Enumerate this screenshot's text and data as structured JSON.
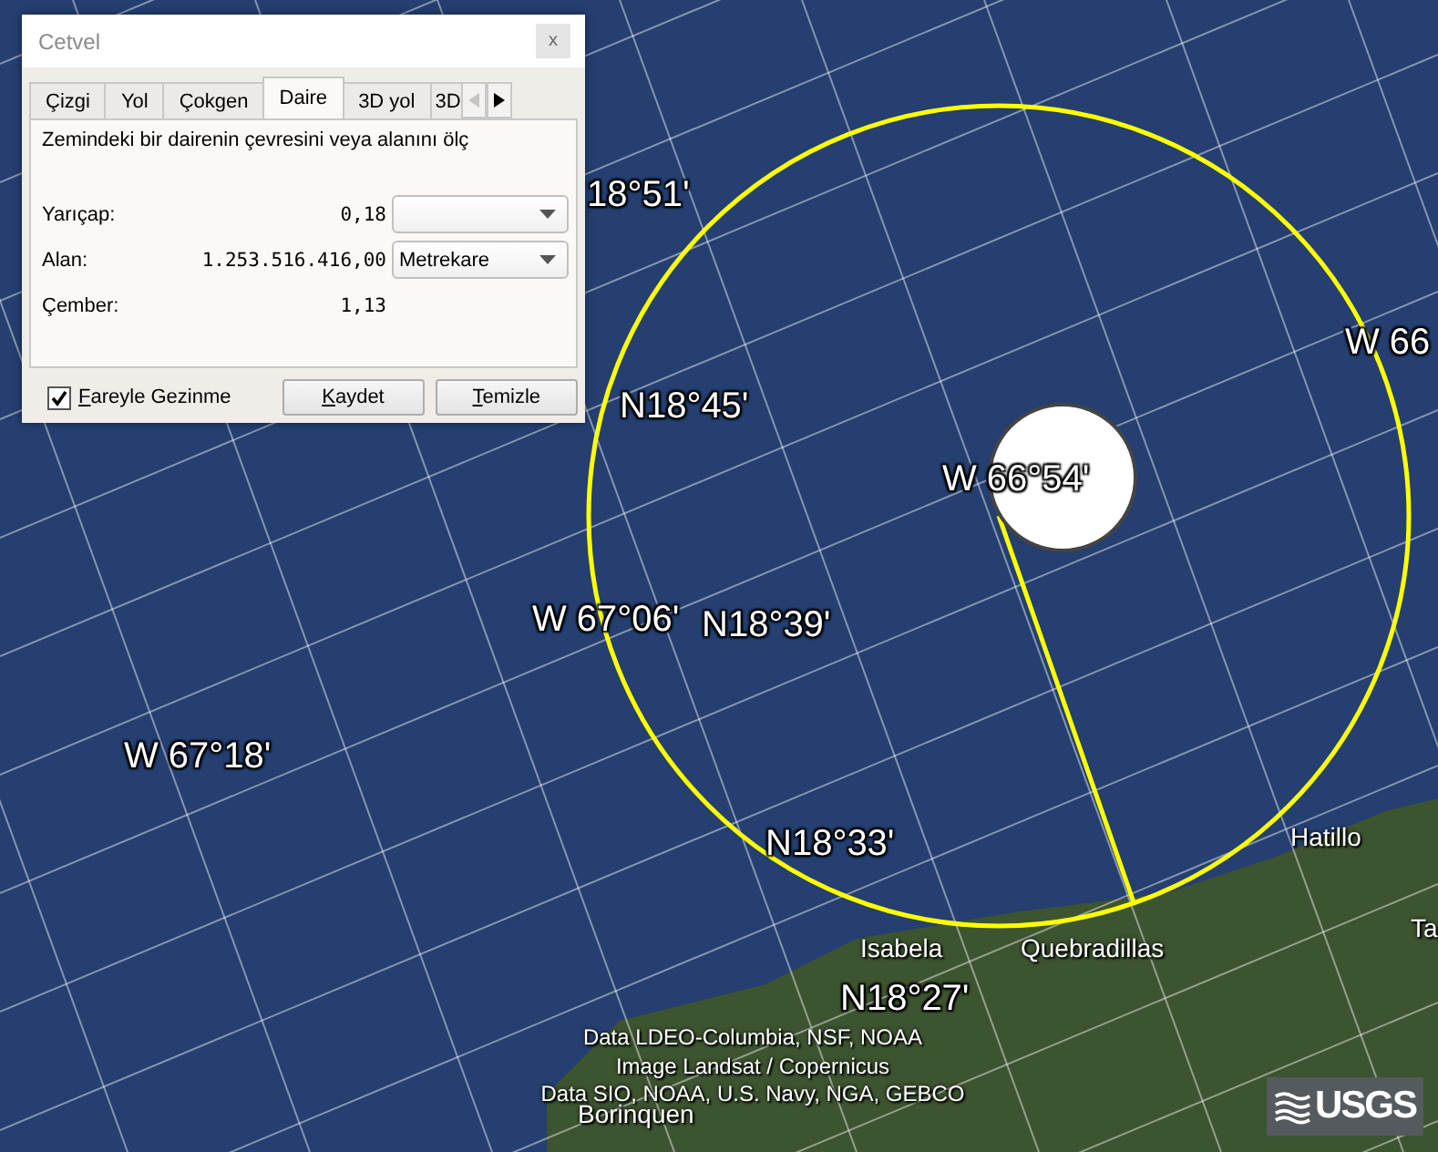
{
  "map": {
    "grid_labels": [
      "18°51'",
      "W 66",
      "N18°45'",
      "W 66°54'",
      "W 67°06'",
      "N18°39'",
      "W 67°18'",
      "N18°33'",
      "N18°27'"
    ],
    "place_labels": [
      "Hatillo",
      "Ta",
      "Isabela",
      "Quebradillas",
      "Borinquen"
    ],
    "attribution": [
      "Data LDEO-Columbia, NSF, NOAA",
      "Image Landsat / Copernicus",
      "Data SIO, NOAA, U.S. Navy, NGA, GEBCO"
    ],
    "logo": "USGS"
  },
  "dialog": {
    "title": "Cetvel",
    "close": "x",
    "tabs": [
      {
        "label": "Çizgi",
        "selected": false
      },
      {
        "label": "Yol",
        "selected": false
      },
      {
        "label": "Çokgen",
        "selected": false
      },
      {
        "label": "Daire",
        "selected": true
      },
      {
        "label": "3D yol",
        "selected": false
      },
      {
        "label": "3D",
        "selected": false
      }
    ],
    "description": "Zemindeki bir dairenin çevresini veya alanını ölç",
    "rows": [
      {
        "label": "Yarıçap:",
        "value": "0,18",
        "kind": "dropdown"
      },
      {
        "label": "Alan:",
        "value": "1.253.516.416,00",
        "kind": "dropdown",
        "unit": "Metrekare"
      },
      {
        "label": "Çember:",
        "value": "1,13",
        "kind": "plain"
      }
    ],
    "mouse_nav": {
      "label": "Fareyle Gezinme",
      "checked": true
    },
    "buttons": [
      "Kaydet",
      "Temizle"
    ]
  }
}
